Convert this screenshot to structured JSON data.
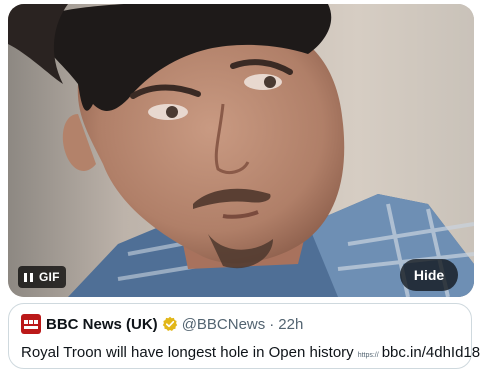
{
  "media": {
    "gif_badge": "GIF",
    "hide_label": "Hide"
  },
  "tweet": {
    "display_name": "BBC News (UK)",
    "handle": "@BBCNews",
    "separator": "·",
    "time": "22h",
    "text": "Royal Troon will have longest hole in Open history",
    "link_prefix": "https://",
    "link_text": "bbc.in/4dhId18"
  },
  "colors": {
    "verified_badge": "#e2b719",
    "avatar_bg": "#bb1919",
    "handle_gray": "#536471"
  },
  "icons": {
    "pause": "pause-icon",
    "verified": "verified-badge-icon",
    "avatar": "bbc-news-logo"
  }
}
